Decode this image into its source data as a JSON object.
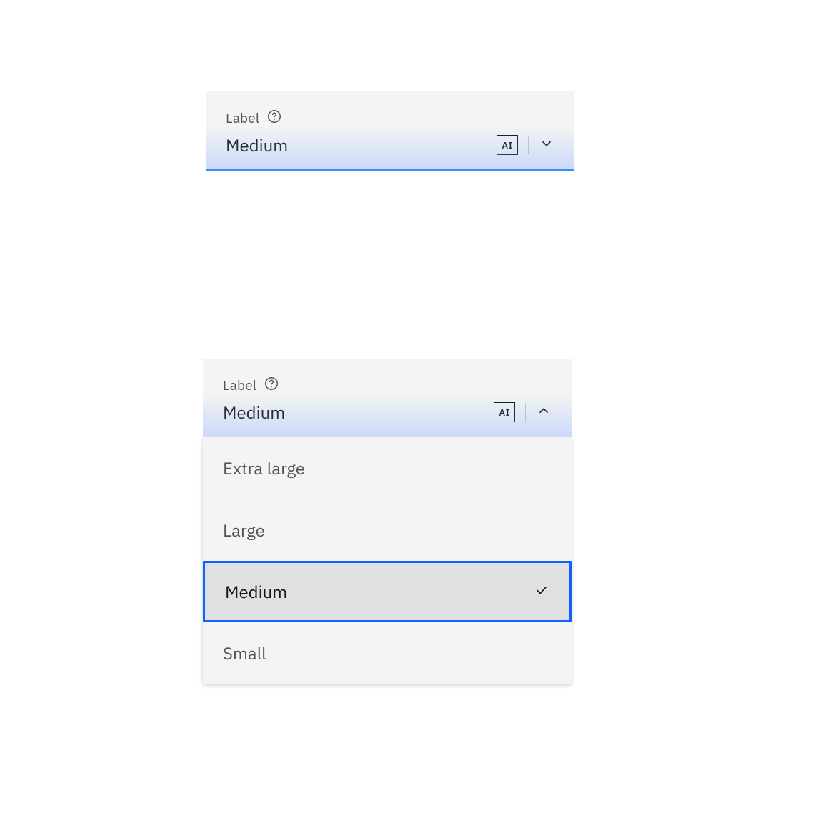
{
  "dropdown_closed": {
    "label": "Label",
    "selected": "Medium",
    "ai_badge": "AI"
  },
  "dropdown_open": {
    "label": "Label",
    "selected": "Medium",
    "ai_badge": "AI",
    "options": [
      {
        "label": "Extra large",
        "selected": false
      },
      {
        "label": "Large",
        "selected": false
      },
      {
        "label": "Medium",
        "selected": true
      },
      {
        "label": "Small",
        "selected": false
      }
    ]
  }
}
